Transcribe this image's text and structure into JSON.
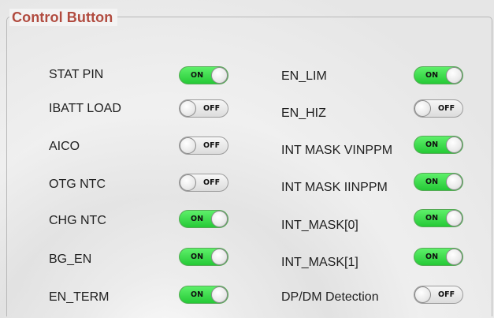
{
  "panel": {
    "title": "Control Button"
  },
  "left": [
    {
      "label": "STAT PIN",
      "state": "ON"
    },
    {
      "label": "IBATT LOAD",
      "state": "OFF"
    },
    {
      "label": "AICO",
      "state": "OFF"
    },
    {
      "label": "OTG NTC",
      "state": "OFF"
    },
    {
      "label": "CHG NTC",
      "state": "ON"
    },
    {
      "label": "BG_EN",
      "state": "ON"
    },
    {
      "label": "EN_TERM",
      "state": "ON"
    }
  ],
  "right": [
    {
      "label": "EN_LIM",
      "state": "ON"
    },
    {
      "label": "EN_HIZ",
      "state": "OFF"
    },
    {
      "label": "INT MASK VINPPM",
      "state": "ON"
    },
    {
      "label": "INT MASK IINPPM",
      "state": "ON"
    },
    {
      "label": "INT_MASK[0]",
      "state": "ON"
    },
    {
      "label": "INT_MASK[1]",
      "state": "ON"
    },
    {
      "label": "DP/DM Detection",
      "state": "OFF"
    }
  ],
  "colors": {
    "title": "#b14b3f",
    "toggle_on": "#2fd23f",
    "toggle_off": "#e6e6e6"
  }
}
